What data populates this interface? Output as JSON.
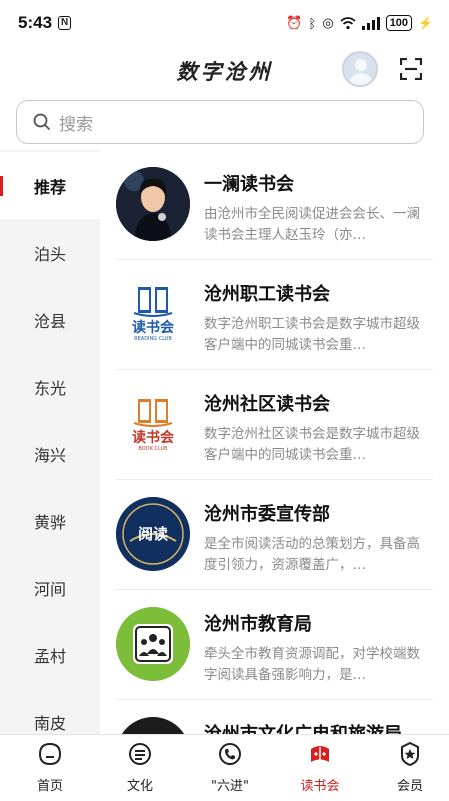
{
  "status_bar": {
    "time": "5:43",
    "nfc": "N",
    "battery": "100"
  },
  "header": {
    "title": "数字沧州"
  },
  "search": {
    "placeholder": "搜索"
  },
  "sidebar": {
    "items": [
      "推荐",
      "泊头",
      "沧县",
      "东光",
      "海兴",
      "黄骅",
      "河间",
      "孟村",
      "南皮"
    ],
    "active_index": 0
  },
  "clubs": [
    {
      "name": "一澜读书会",
      "description": "由沧州市全民阅读促进会会长、一澜读书会主理人赵玉玲（亦…",
      "logo": "portrait-photo"
    },
    {
      "name": "沧州职工读书会",
      "description": "数字沧州职工读书会是数字城市超级客户端中的同城读书会重…",
      "logo_text": "读书会",
      "logo_sub": "READING CLUB"
    },
    {
      "name": "沧州社区读书会",
      "description": "数字沧州社区读书会是数字城市超级客户端中的同城读书会重…",
      "logo_text": "读书会",
      "logo_sub": "BOOK CLUB"
    },
    {
      "name": "沧州市委宣传部",
      "description": "是全市阅读活动的总策划方，具备高度引领力，资源覆盖广，…",
      "logo_text": "阅读"
    },
    {
      "name": "沧州市教育局",
      "description": "牵头全市教育资源调配，对学校端数字阅读具备强影响力，是…",
      "logo": "people-group"
    },
    {
      "name": "沧州市文化广电和旅游局",
      "description": "",
      "logo": "dark-circle"
    }
  ],
  "tabbar": {
    "items": [
      {
        "label": "首页",
        "icon": "home-face-icon"
      },
      {
        "label": "文化",
        "icon": "list-icon"
      },
      {
        "label": "\"六进\"",
        "icon": "phone-icon"
      },
      {
        "label": "读书会",
        "icon": "book-club-icon"
      },
      {
        "label": "会员",
        "icon": "star-badge-icon"
      }
    ],
    "active_index": 3
  },
  "colors": {
    "accent": "#d81e1e",
    "sidebar_bg": "#f4f4f4",
    "muted_text": "#8a8a8a"
  }
}
